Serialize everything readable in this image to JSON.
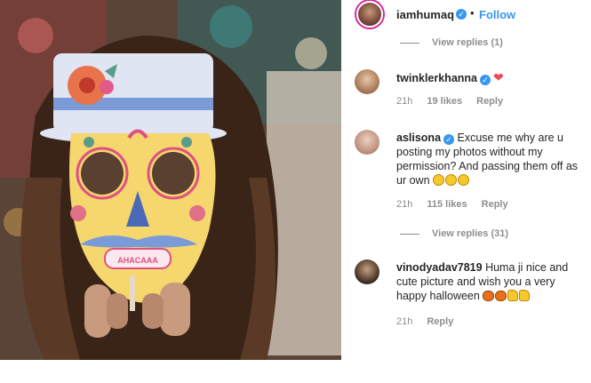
{
  "post": {
    "username": "iamhumaq",
    "follow_label": "Follow",
    "separator": "•"
  },
  "comments": [
    {
      "view_replies": "View replies (1)"
    },
    {
      "username": "twinklerkhanna",
      "text": "",
      "heart": "❤",
      "time": "21h",
      "likes": "19 likes",
      "reply": "Reply"
    },
    {
      "username": "aslisona",
      "text": "Excuse me why are u posting my photos without my permission? And passing them off as ur own",
      "emoji_names": [
        "crying-laughing-face",
        "crying-laughing-face",
        "crying-laughing-face"
      ],
      "time": "21h",
      "likes": "115 likes",
      "reply": "Reply",
      "view_replies": "View replies (31)"
    },
    {
      "username": "vinodyadav7819",
      "text": "Huma ji nice and cute picture and wish you a very happy halloween",
      "emoji_names": [
        "pumpkin",
        "pumpkin",
        "thumbs-up",
        "thumbs-up"
      ],
      "time": "21h",
      "reply": "Reply"
    }
  ],
  "mask": {
    "teeth_text": "AHACAAA"
  },
  "colors": {
    "accent": "#3897f0",
    "muted": "#8e8e8e",
    "heart": "#ed4956",
    "mask_yellow": "#f5d76e",
    "hat_blue": "#7a9ad8"
  }
}
